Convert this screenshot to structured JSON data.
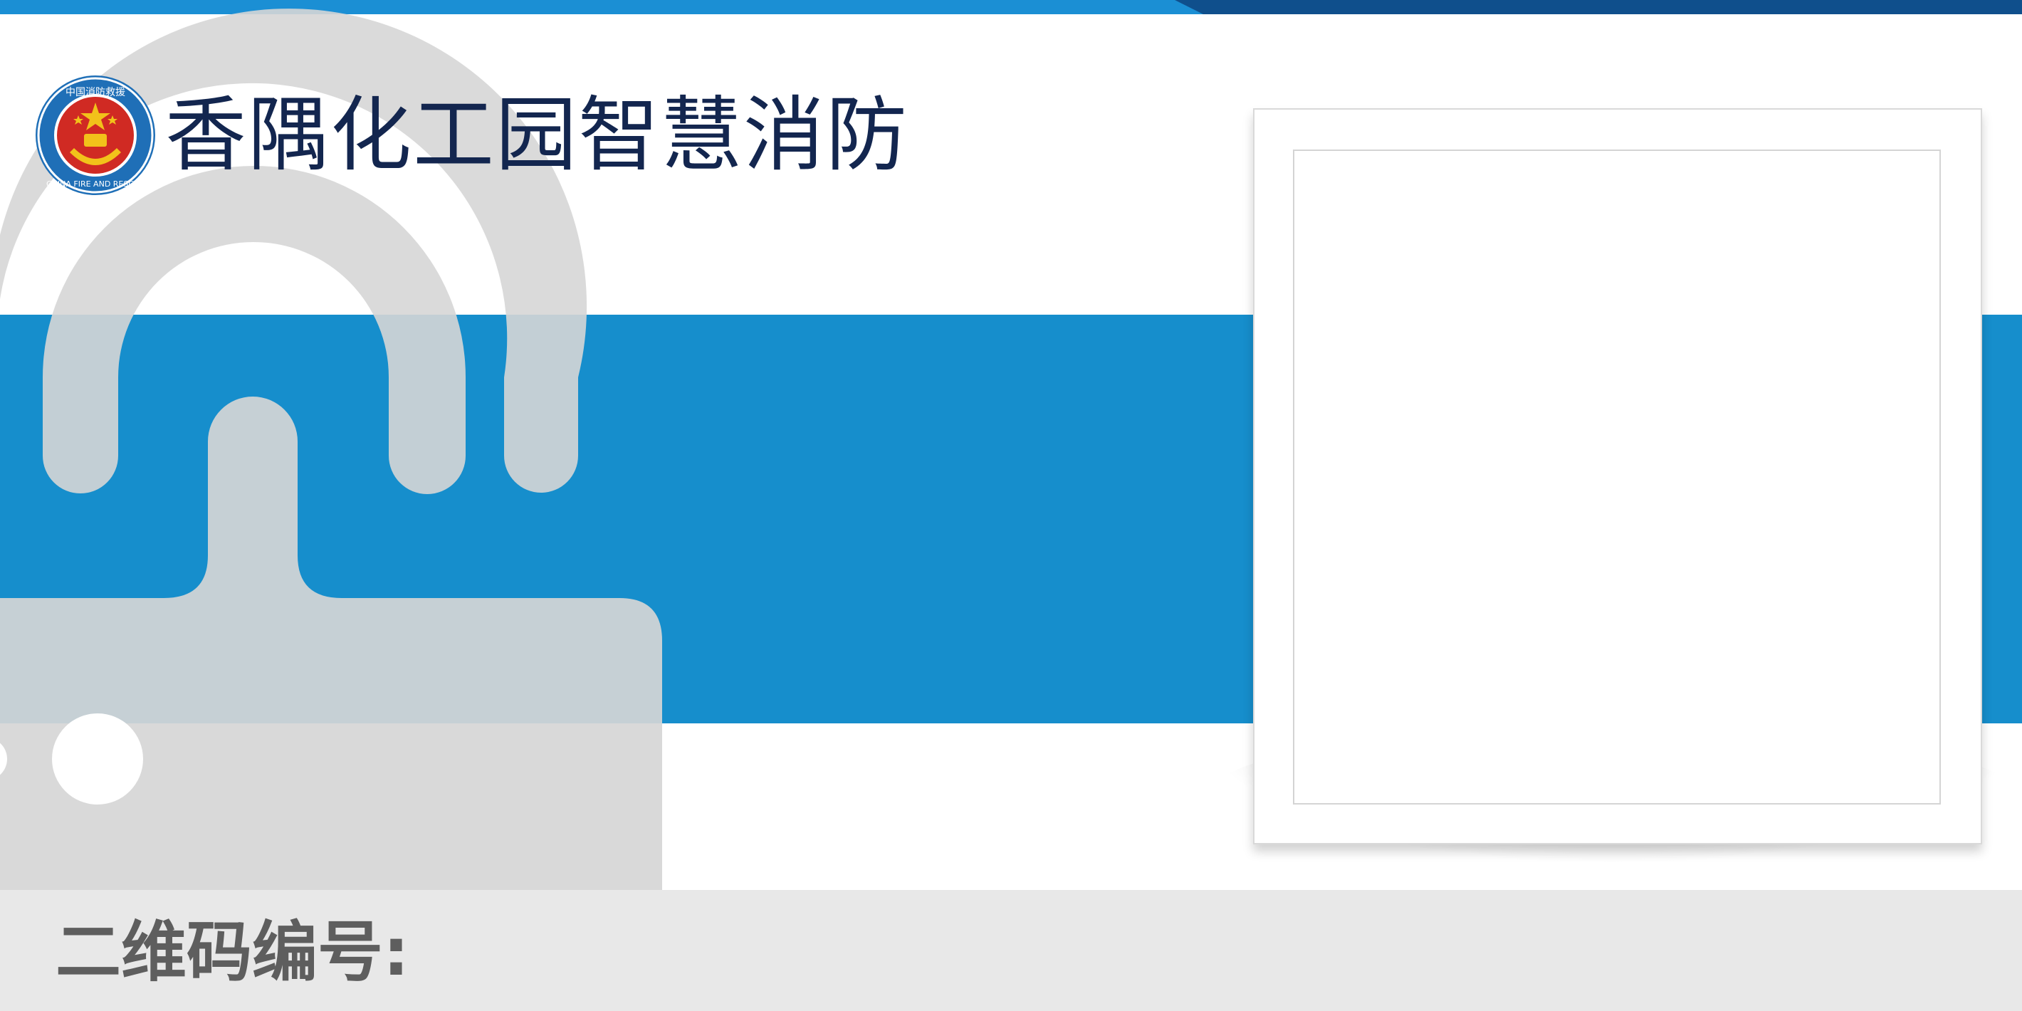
{
  "colors": {
    "top_bar_light": "#1b8fd4",
    "top_bar_dark": "#0f4f8c",
    "band_blue": "#168ecc",
    "title_color": "#13264f",
    "lock_gray": "#d6d6d6",
    "footer_gray": "#e8e8e8",
    "label_gray": "#5e5e5e"
  },
  "header": {
    "emblem_icon": "china-fire-and-rescue-emblem",
    "title": "香隅化工园智慧消防"
  },
  "emblem": {
    "top_text": "中国消防救援",
    "bottom_text": "CHINA FIRE AND RESCUE"
  },
  "decoration": {
    "background_icon": "padlock-icon"
  },
  "qr_panel": {
    "placeholder_icon": "qr-code-frame"
  },
  "footer": {
    "label": "二维码编号:"
  }
}
